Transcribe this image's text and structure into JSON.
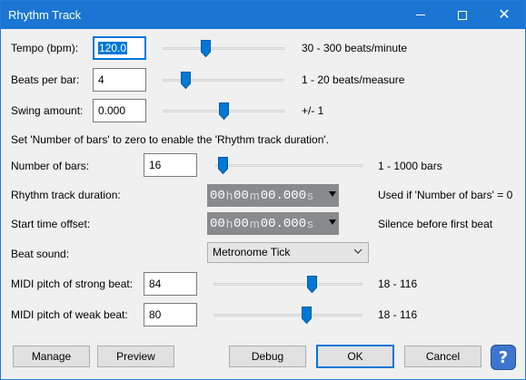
{
  "window": {
    "title": "Rhythm Track"
  },
  "tempo": {
    "label": "Tempo (bpm):",
    "value": "120.0",
    "range": "30 - 300 beats/minute",
    "level": 0.333
  },
  "beats_per_bar": {
    "label": "Beats per bar:",
    "value": "4",
    "range": "1 - 20 beats/measure",
    "level": 0.158
  },
  "swing": {
    "label": "Swing amount:",
    "value": "0.000",
    "range": "+/- 1",
    "level": 0.5
  },
  "instruction": "Set 'Number of bars' to zero to enable the 'Rhythm track duration'.",
  "number_of_bars": {
    "label": "Number of bars:",
    "value": "16",
    "range": "1 - 1000 bars",
    "level": 0.015
  },
  "duration": {
    "label": "Rhythm track duration:",
    "h": "00",
    "m": "00",
    "s": "00.000",
    "unit_h": "h",
    "unit_m": "m",
    "unit_s": "s",
    "note": "Used if 'Number of bars' = 0"
  },
  "start_offset": {
    "label": "Start time offset:",
    "h": "00",
    "m": "00",
    "s": "00.000",
    "unit_h": "h",
    "unit_m": "m",
    "unit_s": "s",
    "note": "Silence before first beat"
  },
  "beat_sound": {
    "label": "Beat sound:",
    "selected": "Metronome Tick"
  },
  "strong_pitch": {
    "label": "MIDI pitch of strong beat:",
    "value": "84",
    "range": "18 - 116",
    "level": 0.673
  },
  "weak_pitch": {
    "label": "MIDI pitch of weak beat:",
    "value": "80",
    "range": "18 - 116",
    "level": 0.633
  },
  "buttons": {
    "manage": "Manage",
    "preview": "Preview",
    "debug": "Debug",
    "ok": "OK",
    "cancel": "Cancel",
    "help": "?"
  },
  "colors": {
    "accent": "#0078d7",
    "titlebar": "#1a76d2",
    "time_bg": "#888a8c"
  },
  "icons": {
    "min": "minimize-icon",
    "max": "maximize-icon",
    "close": "close-icon",
    "help": "help-icon",
    "chevron": "chevron-down-icon"
  }
}
